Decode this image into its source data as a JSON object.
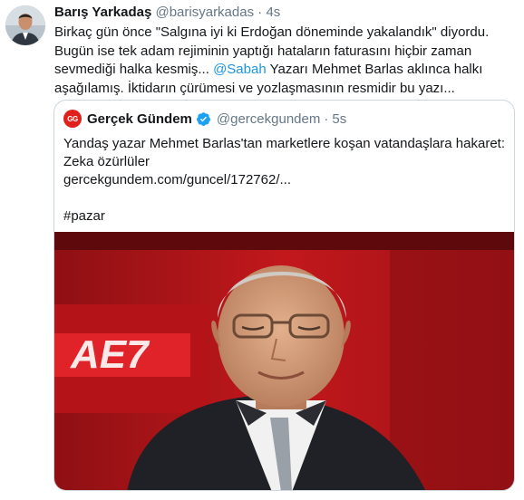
{
  "tweet": {
    "author_name": "Barış Yarkadaş",
    "author_handle": "@barisyarkadas",
    "separator": "·",
    "time": "4s",
    "text_before_mention": "Birkaç gün önce \"Salgına iyi ki Erdoğan döneminde yakalandık\" diyordu. Bugün ise tek adam rejiminin yaptığı hataların faturasını hiçbir zaman sevmediği halka kesmiş... ",
    "mention": "@Sabah",
    "text_after_mention": " Yazarı Mehmet Barlas aklınca halkı aşağılamış. İktidarın çürümesi ve yozlaşmasının resmidir bu yazı...",
    "avatar_icon": "person-avatar"
  },
  "quote": {
    "logo_text": "GG",
    "author_name": "Gerçek Gündem",
    "verified_icon": "verified-badge-icon",
    "author_handle": "@gercekgundem",
    "separator": "·",
    "time": "5s",
    "line1": "Yandaş yazar Mehmet Barlas'tan marketlere koşan vatandaşlara hakaret:",
    "line2": "Zeka özürlüler",
    "link": "gercekgundem.com/guncel/172762/...",
    "hashtag": "#pazar",
    "colors": {
      "accent": "#1b95e0",
      "logo": "#e0201b",
      "border": "#ccd6dd"
    }
  }
}
